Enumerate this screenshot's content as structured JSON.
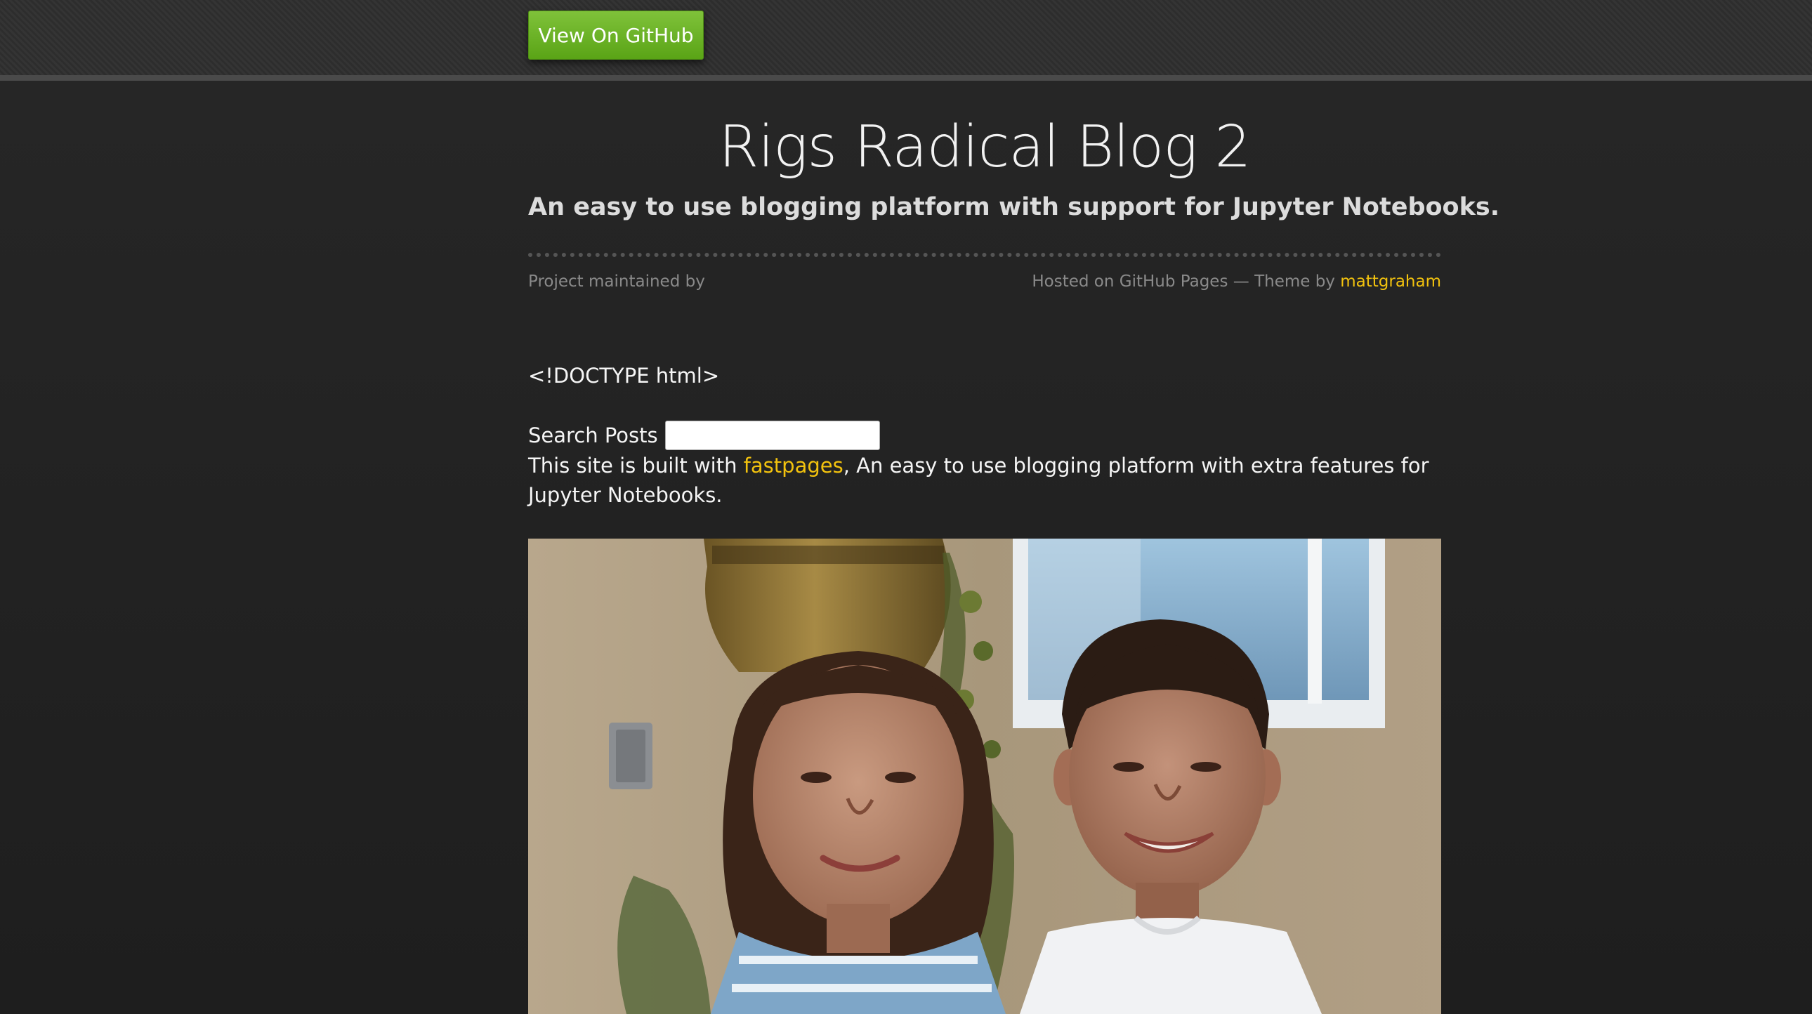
{
  "header": {
    "github_button_label": "View On GitHub"
  },
  "site": {
    "title": "Rigs Radical Blog 2",
    "subtitle": "An easy to use blogging platform with support for Jupyter Notebooks."
  },
  "meta": {
    "maintained_by": "Project maintained by",
    "hosted_prefix": "Hosted on GitHub Pages — Theme by",
    "theme_author_link": "mattgraham"
  },
  "content": {
    "doctype_text": "<!DOCTYPE html>",
    "search_label": "Search Posts",
    "search_value": "",
    "search_placeholder": "",
    "intro_prefix": "This site is built with",
    "intro_link": "fastpages",
    "intro_suffix": ", An easy to use blogging platform with extra features for Jupyter Notebooks."
  },
  "colors": {
    "accent_link": "#f2c20e",
    "button_green": "#6cb229",
    "background": "#232323"
  }
}
